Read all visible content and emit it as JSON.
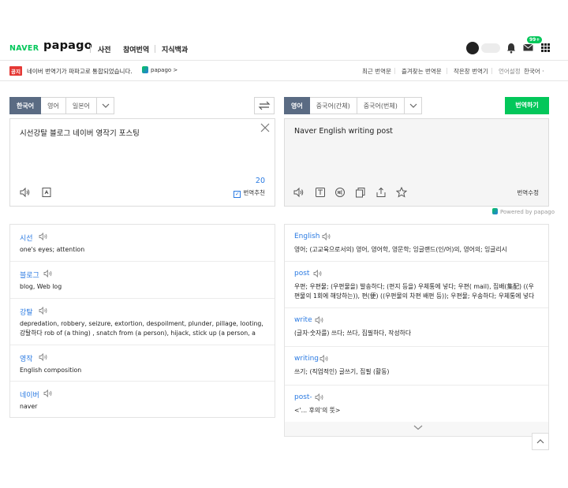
{
  "header": {
    "naver": "NAVER",
    "papago": "papago",
    "nav": [
      "사전",
      "참여번역",
      "지식백과"
    ],
    "badge": "99+"
  },
  "notice": {
    "badge": "공지",
    "text": "네이버 번역기가 파파고로 통합되었습니다.",
    "papago_link": "papago >",
    "links": [
      "최근 번역문",
      "즐겨찾는 번역문",
      "작은창 번역기",
      "언어설정",
      "한국어 ·"
    ]
  },
  "source": {
    "tabs": [
      "한국어",
      "영어",
      "일본어"
    ],
    "text": "시선강탈 블로그 네이버 영작기 포스팅",
    "count": "20",
    "recommend": "번역추천"
  },
  "target": {
    "tabs": [
      "영어",
      "중국어(간체)",
      "중국어(번체)"
    ],
    "translate_button": "번역하기",
    "text": "Naver English writing post",
    "edit": "번역수정",
    "powered": "Powered by papago"
  },
  "dict_left": [
    {
      "word": "시선",
      "meaning": "one's eyes; attention"
    },
    {
      "word": "블로그",
      "meaning": "blog, Web log"
    },
    {
      "word": "강탈",
      "meaning": "depredation, robbery, seizure, extortion, despoilment, plunder, pillage, looting, 강탈하다 rob of (a thing) , snatch from (a person), hijack, stick up (a person, a store,"
    },
    {
      "word": "영작",
      "meaning": "English composition"
    },
    {
      "word": "네이버",
      "meaning": "naver"
    }
  ],
  "dict_right": [
    {
      "word": "English",
      "meaning": "영어; (고교육으로서의) 영어, 영어학, 영문학; 잉글랜드(인/어)의, 영어의; 잉글리시"
    },
    {
      "word": "post",
      "meaning": "우편; 우편물; (우편물을) 발송하다; (편지 등을) 우체통에 넣다; 우편( mail), 집배(集配) ((우편물의 1회에 해당하는)), 편(便) ((우편물의 차편 배편 등)); 우편물; 우송하다; 우체통에 넣다"
    },
    {
      "word": "write",
      "meaning": "(글자·숫자를) 쓰다; 쓰다, 집필하다, 작성하다"
    },
    {
      "word": "writing",
      "meaning": "쓰기; (직업적인) 글쓰기, 집필 (활동)"
    },
    {
      "word": "post-",
      "meaning": "<'... 후의'의 뜻>"
    }
  ],
  "colors": {
    "accent": "#03c75a",
    "link": "#2a7ae2",
    "active_tab": "#5a6b83"
  }
}
